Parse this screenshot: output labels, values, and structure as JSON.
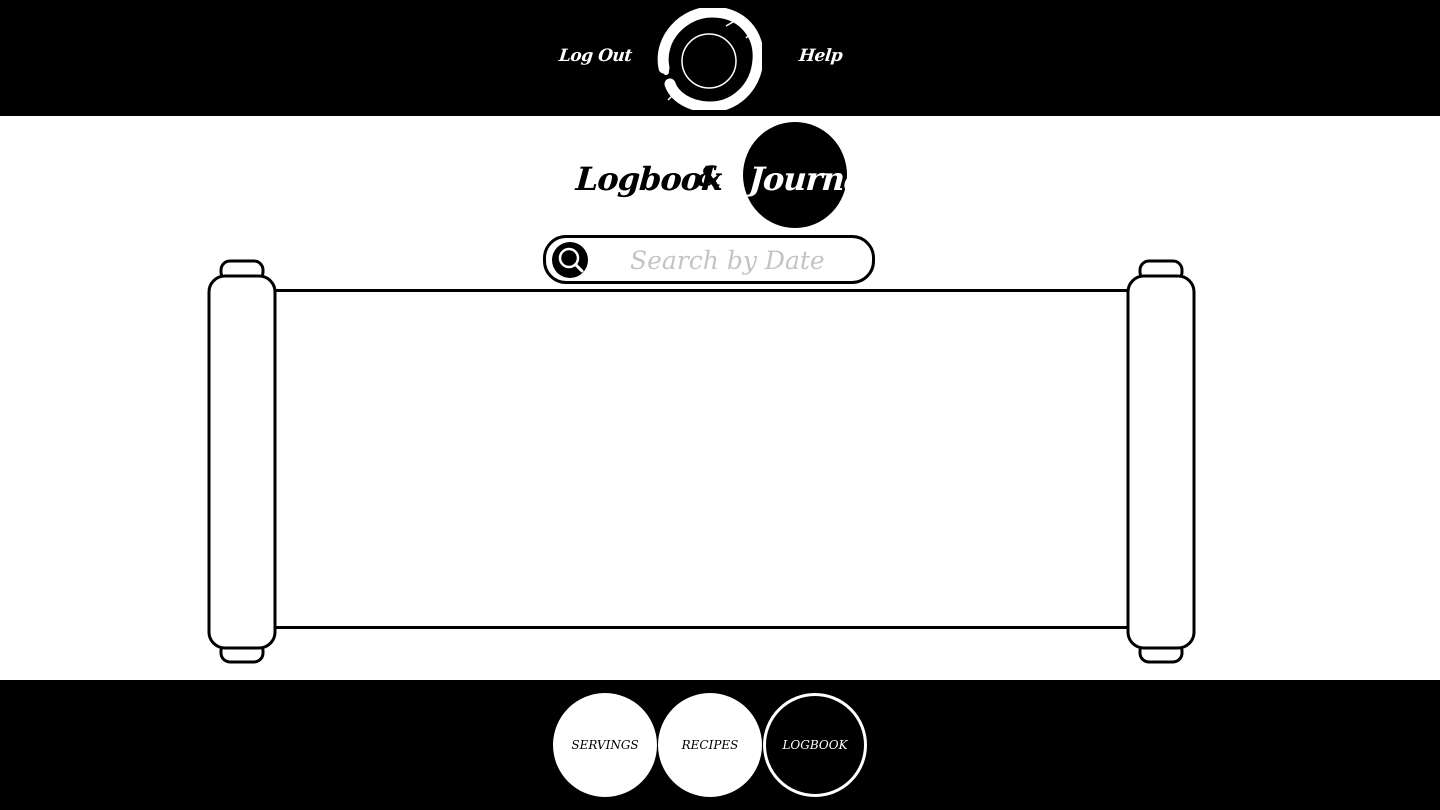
{
  "header": {
    "logout_label": "Log Out",
    "help_label": "Help",
    "logo_icon": "enso-circle-icon"
  },
  "title": {
    "word1": "Logbook",
    "ampersand": "&",
    "word2": "Journal"
  },
  "search": {
    "placeholder": "Search by Date",
    "value": "",
    "icon": "search-icon"
  },
  "content": {
    "scroll_icon": "scroll-icon"
  },
  "nav": {
    "items": [
      {
        "label": "SERVINGS",
        "active": false
      },
      {
        "label": "RECIPES",
        "active": false
      },
      {
        "label": "LOGBOOK",
        "active": true
      }
    ]
  },
  "colors": {
    "primary": "#000000",
    "background": "#ffffff",
    "placeholder": "#c4c4c4"
  }
}
